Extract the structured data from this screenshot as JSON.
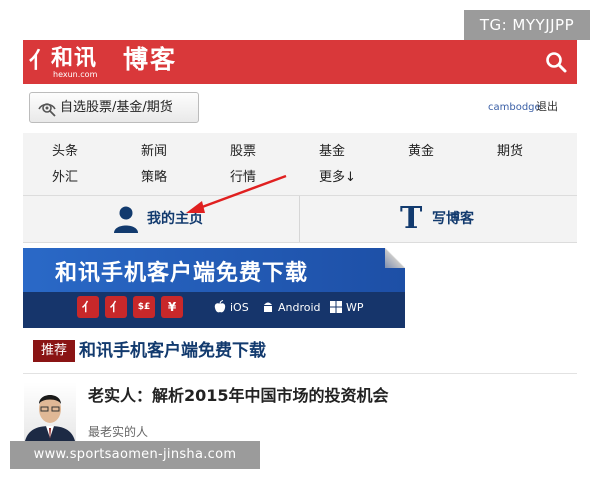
{
  "overlays": {
    "tg_label": "TG: MYYJJPP",
    "watermark": "www.sportsaomen-jinsha.com"
  },
  "header": {
    "logo_mark": "亻",
    "logo_cn": "和讯",
    "logo_domain": "hexun.com",
    "blog_label": "博客",
    "brand_color": "#d9383a",
    "search_icon": "search-icon"
  },
  "toolbar": {
    "watchlist_label": "自选股票/基金/期货",
    "username": "cambodge",
    "logout_label": "退出"
  },
  "nav": {
    "row1": [
      "头条",
      "新闻",
      "股票",
      "基金",
      "黄金",
      "期货"
    ],
    "row2": [
      "外汇",
      "策略",
      "行情",
      "更多↓"
    ]
  },
  "tabs": {
    "home_label": "我的主页",
    "write_label": "写博客",
    "write_icon_letter": "T",
    "accent_color": "#123a6e"
  },
  "banner": {
    "title": "和讯手机客户端免费下载",
    "app_marks": [
      "亻",
      "亻",
      "$£",
      "¥"
    ],
    "platforms": [
      "iOS",
      "Android",
      "WP"
    ]
  },
  "promo": {
    "badge": "推荐",
    "text": "和讯手机客户端免费下载"
  },
  "article": {
    "title": "老实人：解析2015年中国市场的投资机会",
    "author": "最老实的人"
  }
}
